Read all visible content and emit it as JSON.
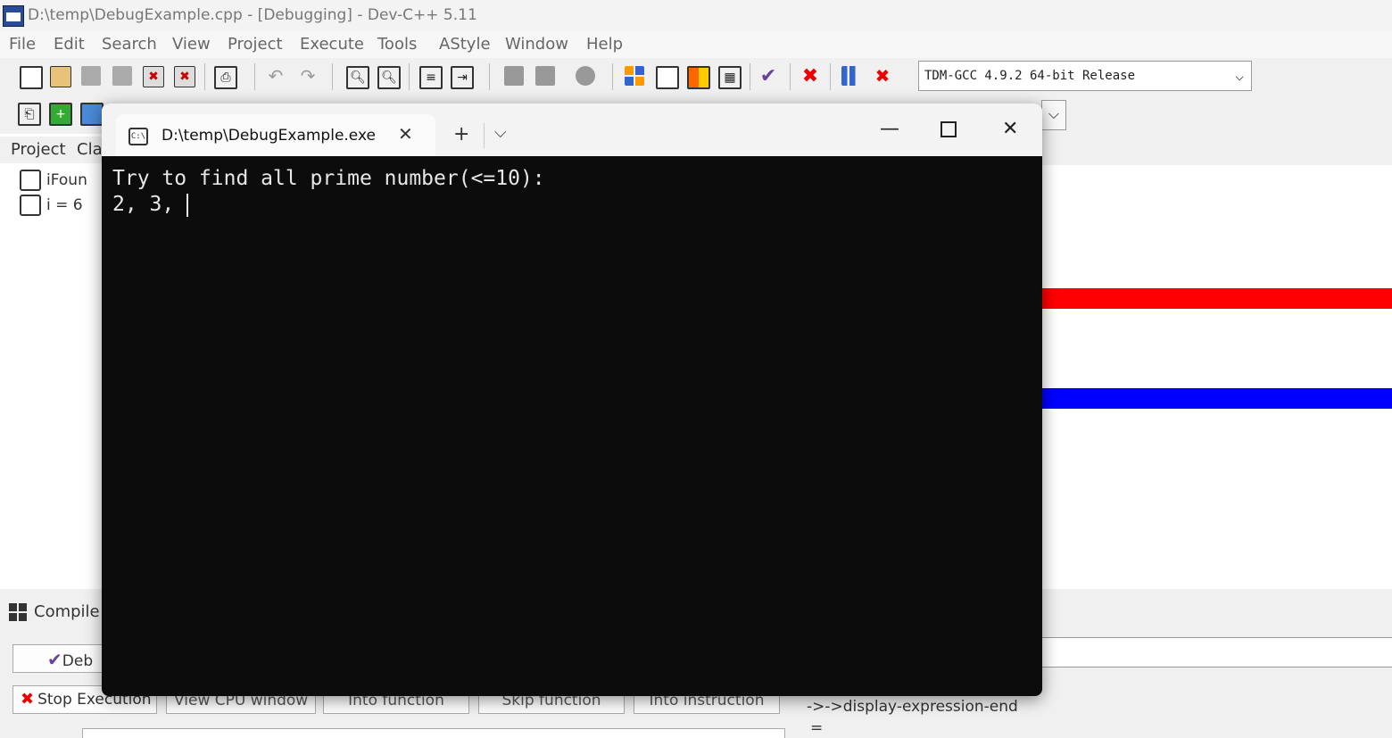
{
  "window": {
    "title": "D:\\temp\\DebugExample.cpp - [Debugging] - Dev-C++ 5.11"
  },
  "menu": [
    "File",
    "Edit",
    "Search",
    "View",
    "Project",
    "Execute",
    "Tools",
    "AStyle",
    "Window",
    "Help"
  ],
  "compiler": {
    "selected": "TDM-GCC 4.9.2 64-bit Release"
  },
  "left_panel": {
    "tabs": [
      "Project",
      "Cla"
    ],
    "watches": [
      "iFoun",
      "i = 6"
    ]
  },
  "bottom": {
    "compile_tab": "Compile",
    "debug_button": "Deb",
    "stop_button": "Stop Execution",
    "buttons": [
      "View CPU window",
      "Into function",
      "Skip function",
      "Into instruction"
    ],
    "output_lines": [
      "->->display-expression-end",
      "="
    ]
  },
  "console": {
    "tab_title": "D:\\temp\\DebugExample.exe",
    "new_tab": "+",
    "line1": "Try to find all prime number(<=10):",
    "line2": "2, 3, "
  },
  "colors": {
    "highlight_red": "#ff0000",
    "highlight_blue": "#0000ff",
    "console_bg": "#0c0c0c"
  }
}
